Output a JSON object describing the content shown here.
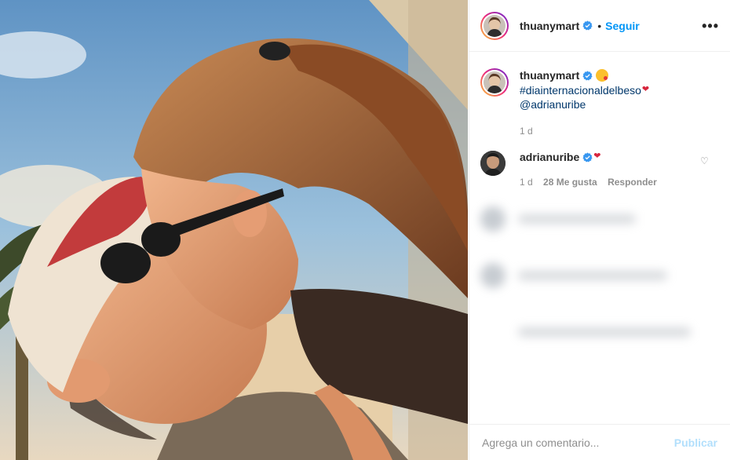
{
  "post": {
    "author": "thuanymart",
    "follow_label": "Seguir",
    "dot": "•",
    "more_icon": "more-horizontal-icon",
    "caption": {
      "username": "thuanymart",
      "hashtag": "#diainternacionaldelbeso",
      "mention": "@adrianuribe",
      "time": "1 d"
    }
  },
  "comments": [
    {
      "username": "adrianuribe",
      "time": "1 d",
      "likes": "28 Me gusta",
      "reply_label": "Responder"
    }
  ],
  "footer": {
    "placeholder": "Agrega un comentario...",
    "post_label": "Publicar"
  },
  "colors": {
    "link": "#0095f6",
    "hashtag": "#00376b",
    "muted": "#8e8e8e",
    "post_disabled": "#b2dffc"
  }
}
